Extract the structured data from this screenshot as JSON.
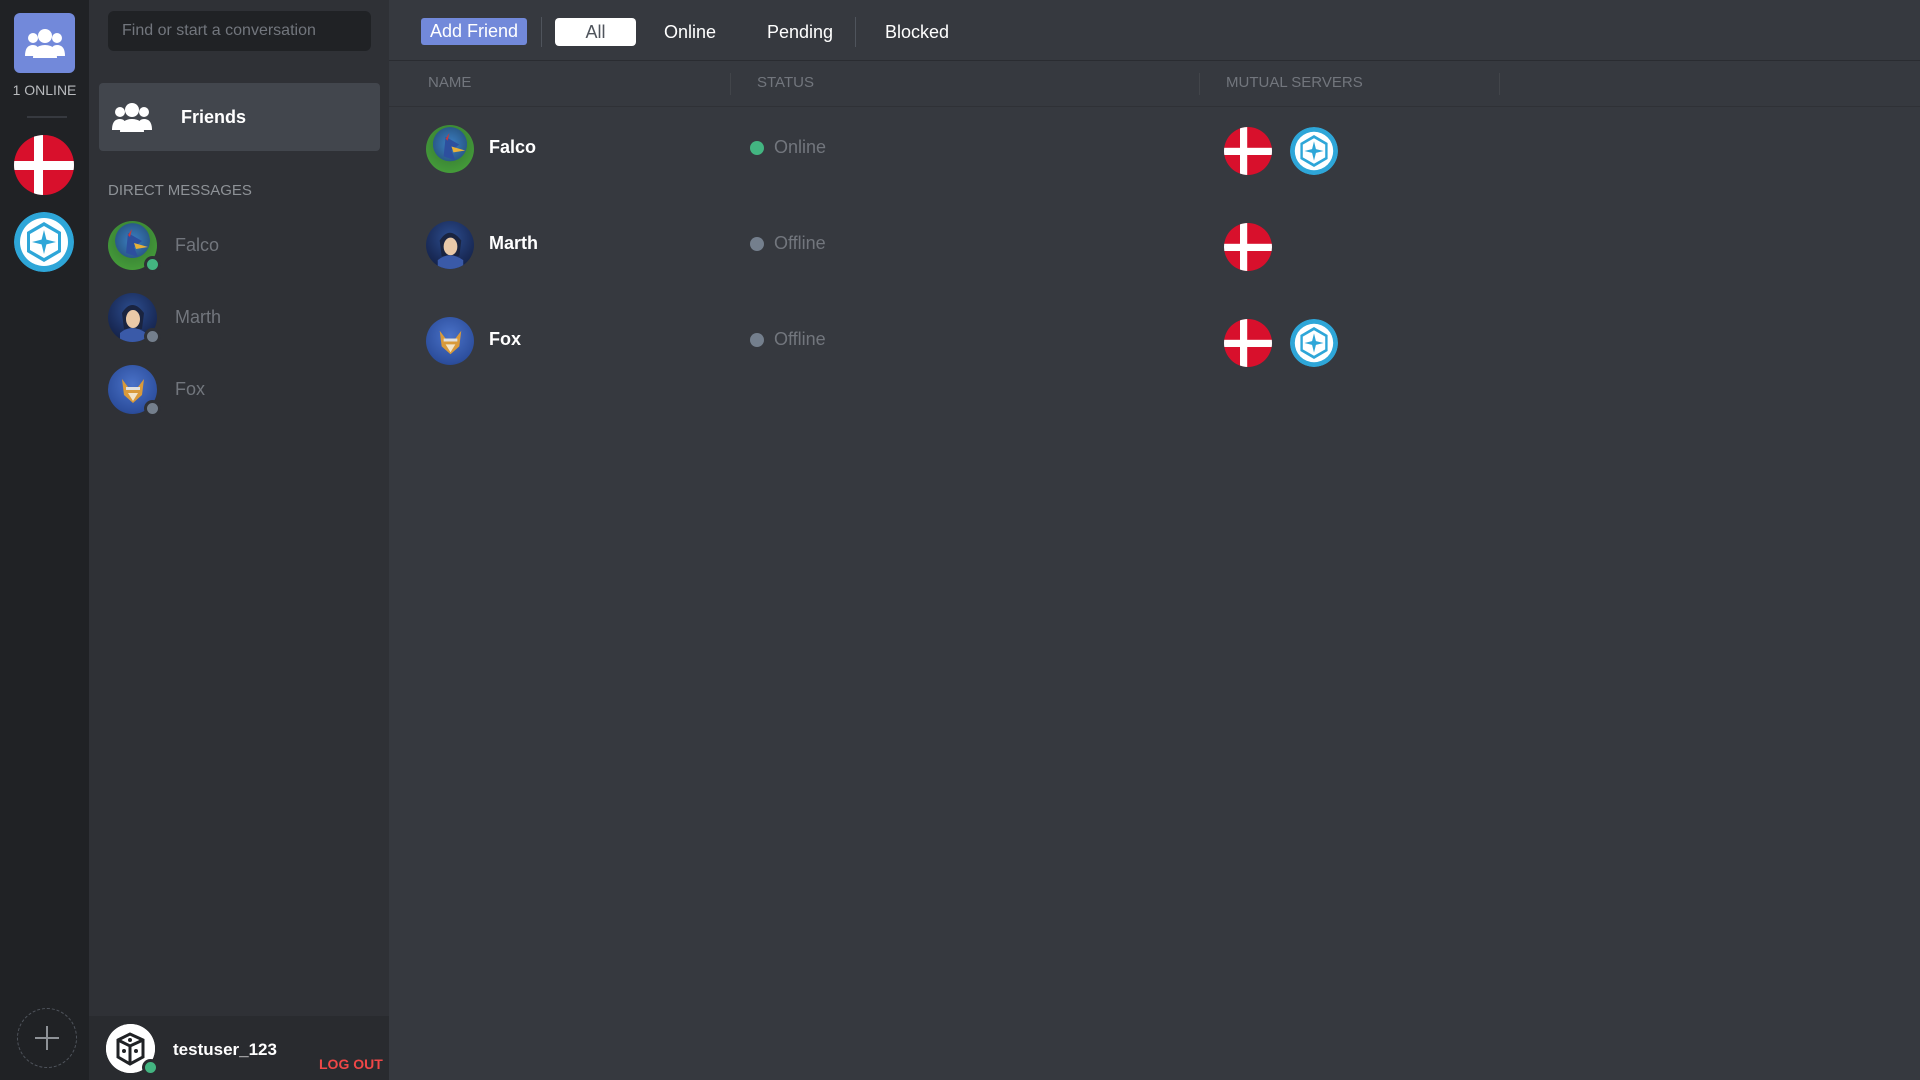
{
  "rail": {
    "online_count": "1 ONLINE",
    "servers": [
      {
        "name": "denmark-server",
        "color": "#d8102c"
      },
      {
        "name": "compass-server",
        "color": "#2ea6d8"
      }
    ]
  },
  "sidebar": {
    "search_placeholder": "Find or start a conversation",
    "friends_label": "Friends",
    "dm_header": "DIRECT MESSAGES",
    "dms": [
      {
        "name": "Falco",
        "status": "online"
      },
      {
        "name": "Marth",
        "status": "offline"
      },
      {
        "name": "Fox",
        "status": "offline"
      }
    ]
  },
  "user": {
    "username": "testuser_123",
    "logout": "LOG OUT"
  },
  "topbar": {
    "add_friend": "Add Friend",
    "tabs": [
      "All",
      "Online",
      "Pending",
      "Blocked"
    ],
    "active_tab": "All"
  },
  "table": {
    "headers": [
      "NAME",
      "STATUS",
      "MUTUAL SERVERS"
    ],
    "rows": [
      {
        "name": "Falco",
        "status": "Online",
        "mutual": [
          "denmark-server",
          "compass-server"
        ]
      },
      {
        "name": "Marth",
        "status": "Offline",
        "mutual": [
          "denmark-server"
        ]
      },
      {
        "name": "Fox",
        "status": "Offline",
        "mutual": [
          "denmark-server",
          "compass-server"
        ]
      }
    ]
  },
  "colors": {
    "accent": "#7289da",
    "online": "#43b581",
    "offline": "#747f8d",
    "danger": "#f04747"
  }
}
